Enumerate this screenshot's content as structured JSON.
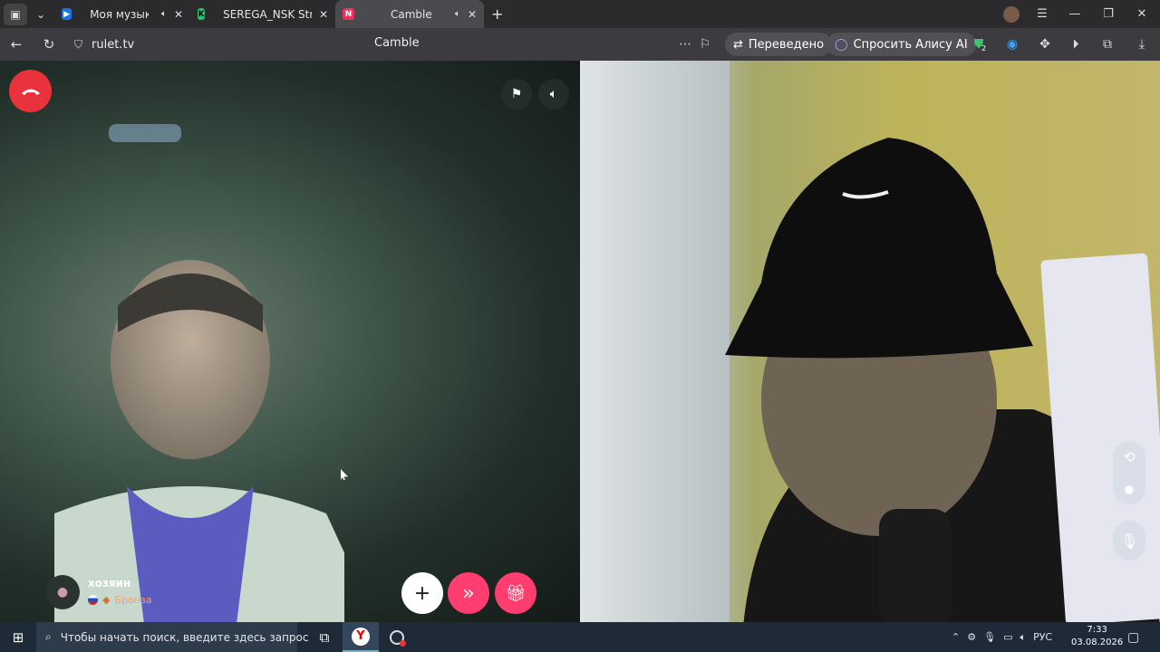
{
  "tabs": [
    {
      "title": "Моя музыка",
      "icon": "play-icon",
      "color": "#1a73e8"
    },
    {
      "title": "SEREGA_NSK Stream - Wa",
      "icon": "kick-icon",
      "color": "#22c55e"
    },
    {
      "title": "Camble",
      "icon": "camble-icon",
      "color": "#e8325c"
    }
  ],
  "address": {
    "url": "rulet.tv",
    "page_title": "Camble"
  },
  "toolbar": {
    "translated_label": "Переведено",
    "alice_label": "Спросить Алису AI",
    "badge_count": "2"
  },
  "chat": {
    "user_name": "хозяин",
    "user_rank": "Бронза",
    "buttons": {
      "add": "+",
      "next": "»",
      "gift": "gift-icon"
    }
  },
  "taskbar": {
    "search_placeholder": "Чтобы начать поиск, введите здесь запрос",
    "lang": "РУС",
    "time": "7:33",
    "date": "03.08.2026"
  },
  "colors": {
    "accent": "#ff3d6e",
    "end_call": "#e8323c"
  }
}
